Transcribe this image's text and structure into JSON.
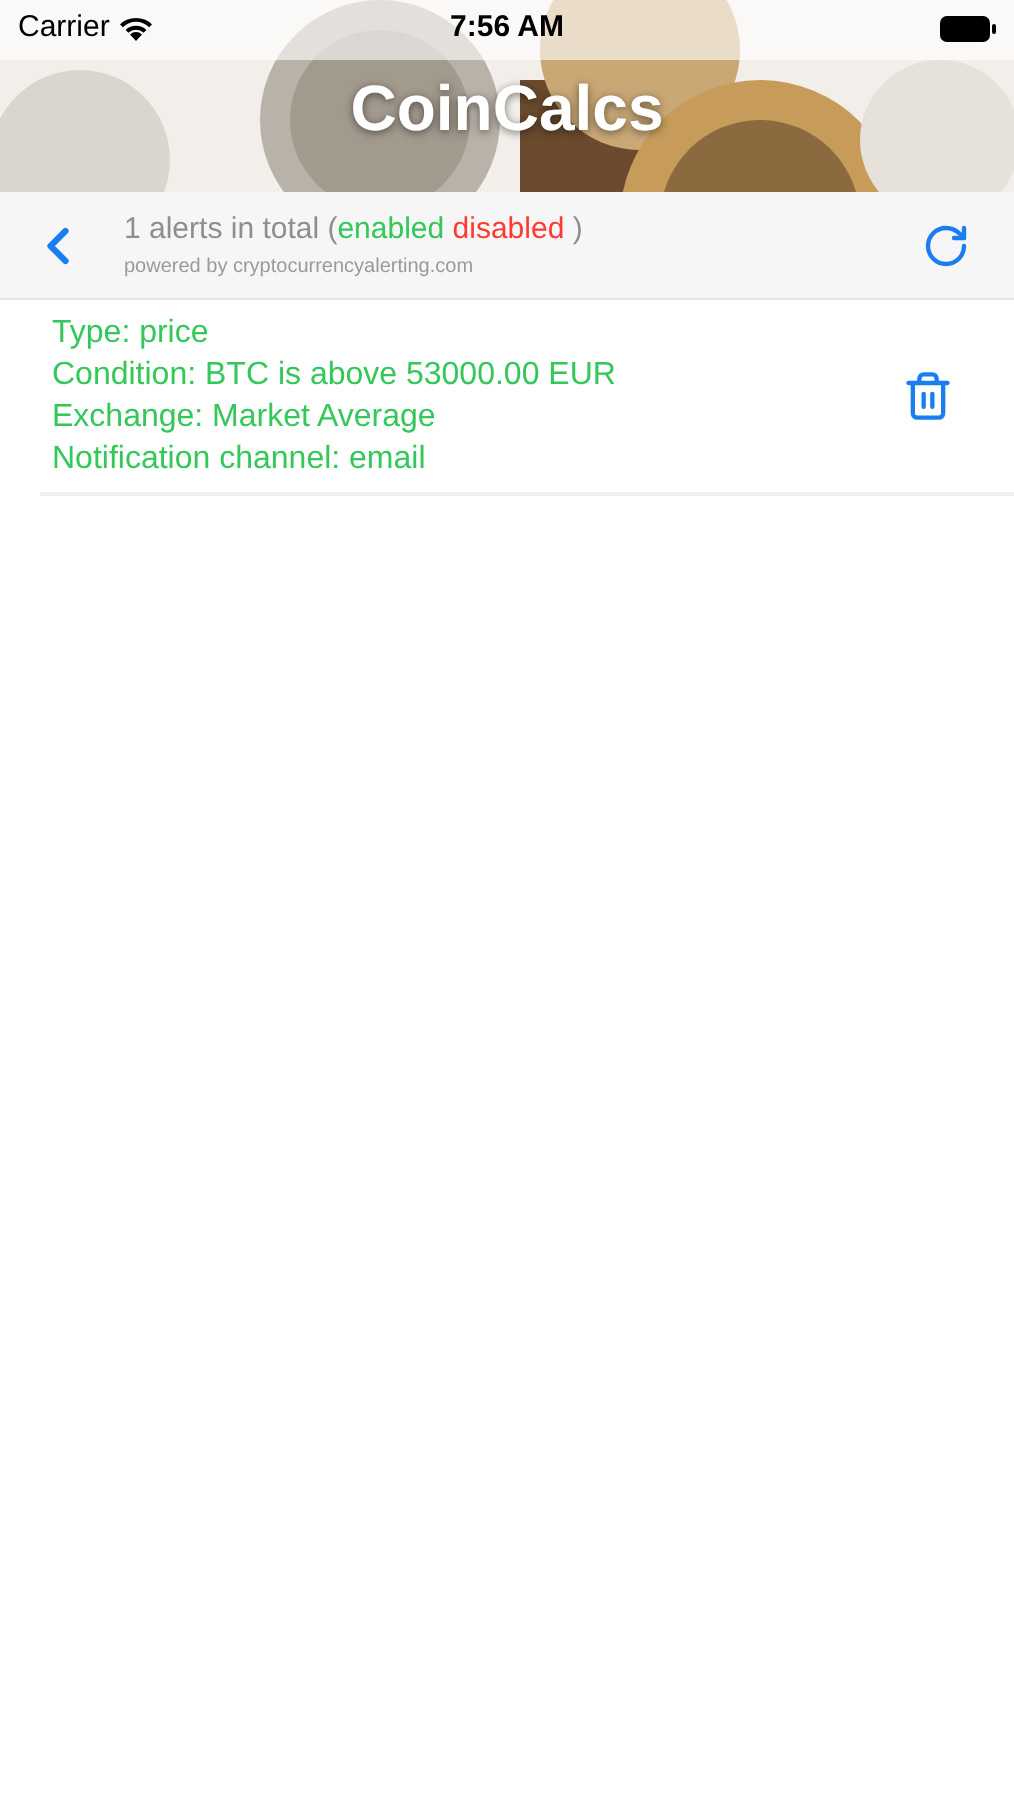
{
  "status_bar": {
    "carrier": "Carrier",
    "time": "7:56 AM"
  },
  "header": {
    "title": "CoinCalcs",
    "kind": "picture"
  },
  "toolbar": {
    "summary": {
      "count_text": "1 alerts in total (",
      "enabled_label": "enabled",
      "disabled_label": "disabled",
      "closing": ")"
    },
    "powered_by": "powered by cryptocurrencyalerting.com"
  },
  "alerts": [
    {
      "enabled": true,
      "lines": [
        "Type: price",
        "Condition: BTC is above 53000.00 EUR",
        "Exchange: Market Average",
        "Notification channel: email"
      ]
    }
  ]
}
